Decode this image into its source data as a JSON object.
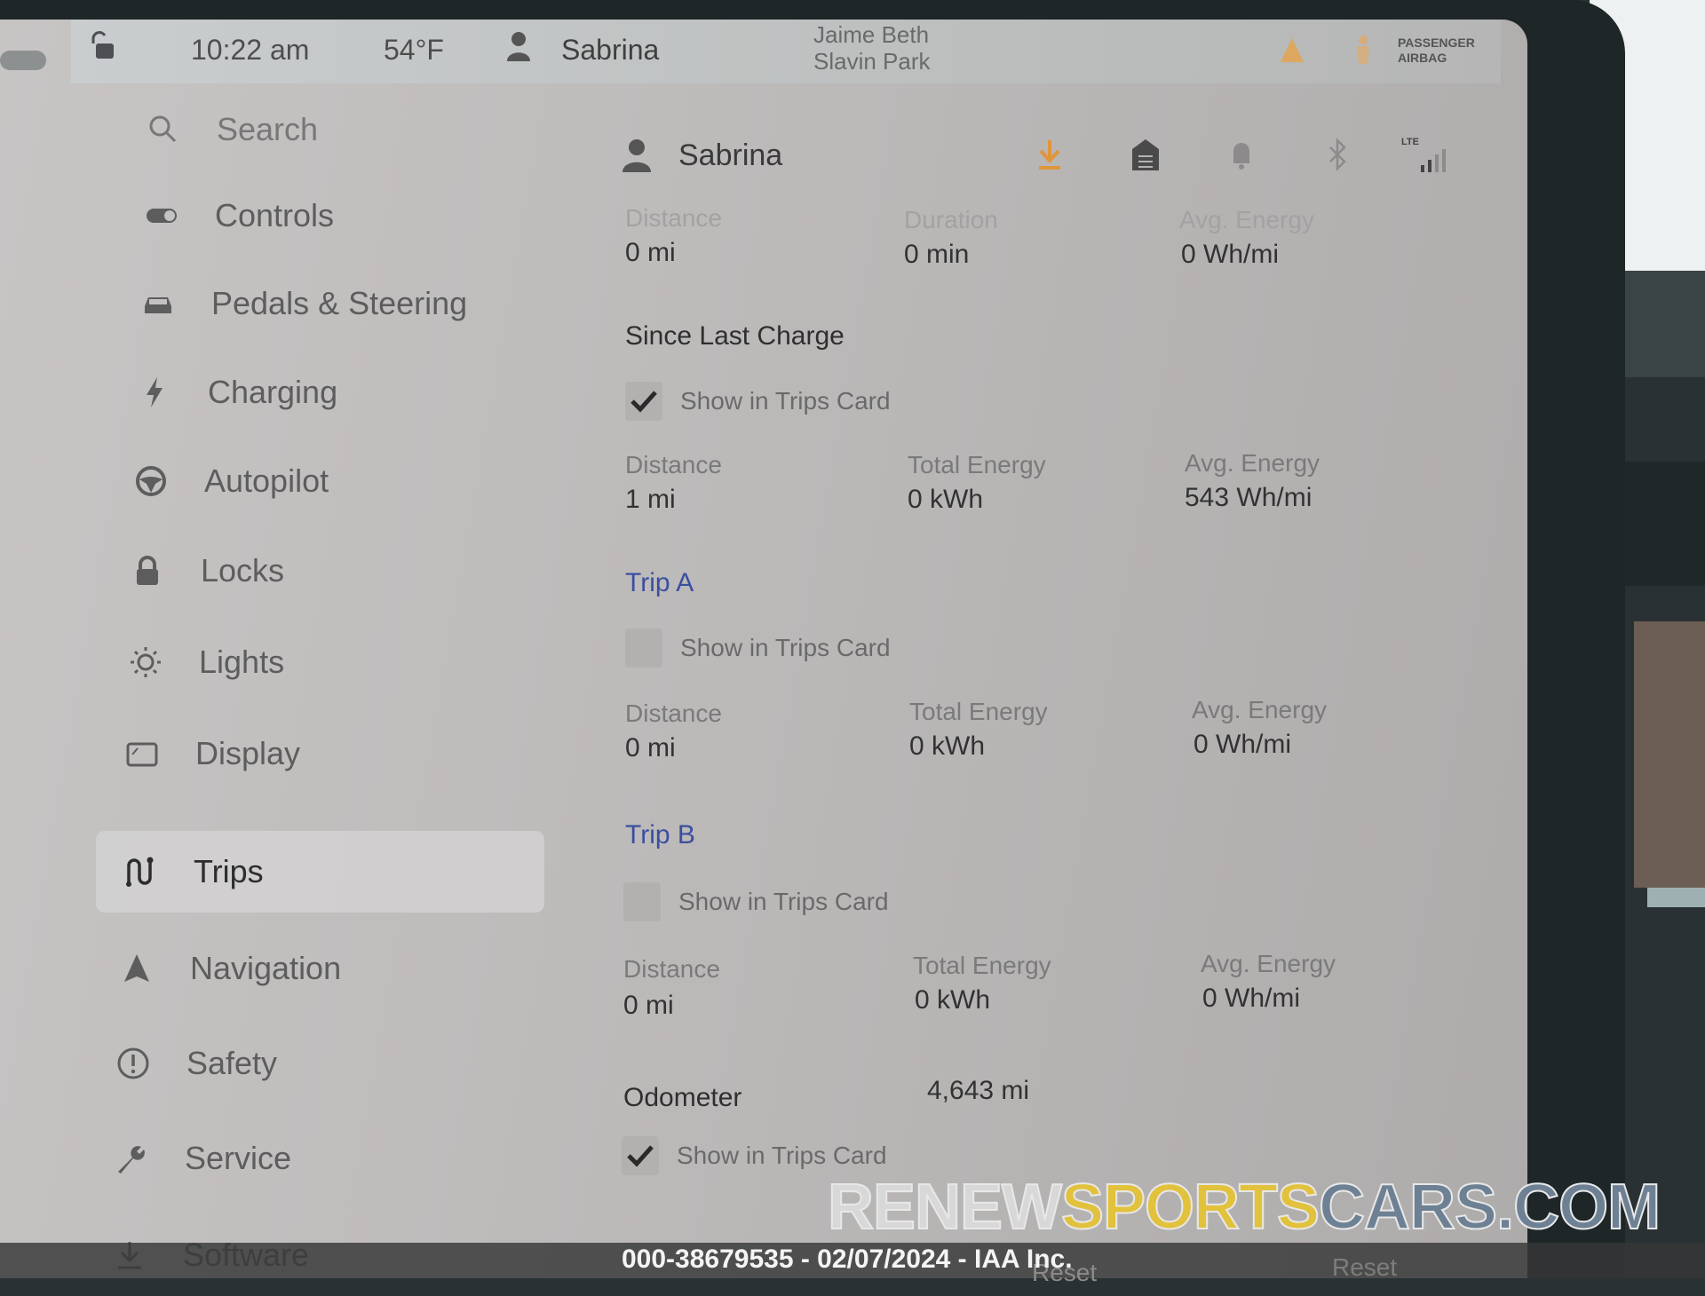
{
  "status_bar": {
    "time": "10:22 am",
    "temperature": "54°F",
    "user_name": "Sabrina",
    "map_label_line1": "Jaime Beth",
    "map_label_line2": "Slavin Park",
    "airbag_line1": "PASSENGER",
    "airbag_line2": "AIRBAG"
  },
  "sidebar": {
    "active": "Trips",
    "items": [
      {
        "label": "Search",
        "icon": "search-icon"
      },
      {
        "label": "Controls",
        "icon": "toggle-icon"
      },
      {
        "label": "Pedals & Steering",
        "icon": "car-icon"
      },
      {
        "label": "Charging",
        "icon": "lightning-icon"
      },
      {
        "label": "Autopilot",
        "icon": "steering-wheel-icon"
      },
      {
        "label": "Locks",
        "icon": "lock-icon"
      },
      {
        "label": "Lights",
        "icon": "light-bulb-icon"
      },
      {
        "label": "Display",
        "icon": "display-icon"
      },
      {
        "label": "Trips",
        "icon": "trips-route-icon"
      },
      {
        "label": "Navigation",
        "icon": "navigation-arrow-icon"
      },
      {
        "label": "Safety",
        "icon": "alert-circle-icon"
      },
      {
        "label": "Service",
        "icon": "wrench-icon"
      },
      {
        "label": "Software",
        "icon": "download-icon"
      }
    ]
  },
  "content": {
    "profile_name": "Sabrina",
    "header_icons": [
      "download-icon",
      "garage-icon",
      "bell-icon",
      "bluetooth-icon",
      "lte-signal-icon"
    ],
    "lte_label": "LTE",
    "current_drive": {
      "distance_label": "Distance",
      "distance_value": "0 mi",
      "duration_label": "Duration",
      "duration_value": "0 min",
      "avg_energy_label": "Avg. Energy",
      "avg_energy_value": "0 Wh/mi"
    },
    "since_last_charge": {
      "title": "Since Last Charge",
      "show_label": "Show in Trips Card",
      "show_checked": true,
      "distance_label": "Distance",
      "distance_value": "1 mi",
      "total_energy_label": "Total Energy",
      "total_energy_value": "0 kWh",
      "avg_energy_label": "Avg. Energy",
      "avg_energy_value": "543 Wh/mi"
    },
    "trip_a": {
      "title": "Trip A",
      "show_label": "Show in Trips Card",
      "show_checked": false,
      "distance_label": "Distance",
      "distance_value": "0 mi",
      "total_energy_label": "Total Energy",
      "total_energy_value": "0 kWh",
      "avg_energy_label": "Avg. Energy",
      "avg_energy_value": "0 Wh/mi"
    },
    "trip_b": {
      "title": "Trip B",
      "show_label": "Show in Trips Card",
      "show_checked": false,
      "distance_label": "Distance",
      "distance_value": "0 mi",
      "total_energy_label": "Total Energy",
      "total_energy_value": "0 kWh",
      "avg_energy_label": "Avg. Energy",
      "avg_energy_value": "0 Wh/mi"
    },
    "odometer": {
      "label": "Odometer",
      "value": "4,643 mi",
      "show_label": "Show in Trips Card",
      "show_checked": true
    },
    "reset_a_label": "Reset",
    "reset_b_label": "Reset"
  },
  "overlay": {
    "caption": "000-38679535 - 02/07/2024 - IAA Inc.",
    "watermark_part1": "RENEW",
    "watermark_part2": "SPORTS",
    "watermark_part3": "CARS.COM",
    "accent_colors": {
      "link": "#3a4fa0",
      "watermark_yellow": "#e2c23c",
      "watermark_blue": "#6e8194"
    }
  }
}
